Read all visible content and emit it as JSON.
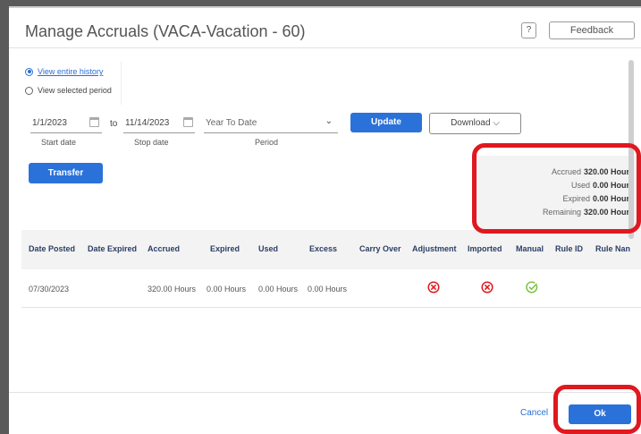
{
  "dialog": {
    "title": "Manage Accruals (VACA-Vacation - 60)"
  },
  "header": {
    "help_label": "?",
    "feedback_label": "Feedback"
  },
  "history_options": [
    {
      "label": "View entire history",
      "selected": true
    },
    {
      "label": "View selected period",
      "selected": false
    }
  ],
  "filters": {
    "start_date": "1/1/2023",
    "start_label": "Start date",
    "to_label": "to",
    "stop_date": "11/14/2023",
    "stop_label": "Stop date",
    "period_value": "Year To Date",
    "period_label": "Period",
    "update_label": "Update",
    "download_label": "Download ⌵"
  },
  "actions": {
    "transfer_label": "Transfer"
  },
  "summary": {
    "accrued_label": "Accrued",
    "accrued_value": "320.00 Hours",
    "used_label": "Used",
    "used_value": "0.00 Hours",
    "expired_label": "Expired",
    "expired_value": "0.00 Hours",
    "remaining_label": "Remaining",
    "remaining_value": "320.00 Hours"
  },
  "table": {
    "columns": [
      "Date Posted",
      "Date Expired",
      "Accrued",
      "Expired",
      "Used",
      "Excess",
      "Carry Over",
      "Adjustment",
      "Imported",
      "Manual",
      "Rule ID",
      "Rule Nan"
    ],
    "rows": [
      {
        "date_posted": "07/30/2023",
        "date_expired": "",
        "accrued": "320.00 Hours",
        "expired": "0.00 Hours",
        "used": "0.00 Hours",
        "excess": "0.00 Hours",
        "carry_over": "",
        "adjustment": "x-circle-icon",
        "imported": "x-circle-icon",
        "manual": "check-circle-icon"
      }
    ]
  },
  "footer": {
    "cancel_label": "Cancel",
    "ok_label": "Ok"
  },
  "colors": {
    "accent": "#2a72d9",
    "error": "#e0181f",
    "success": "#7bc142",
    "highlight": "#e0181f"
  }
}
